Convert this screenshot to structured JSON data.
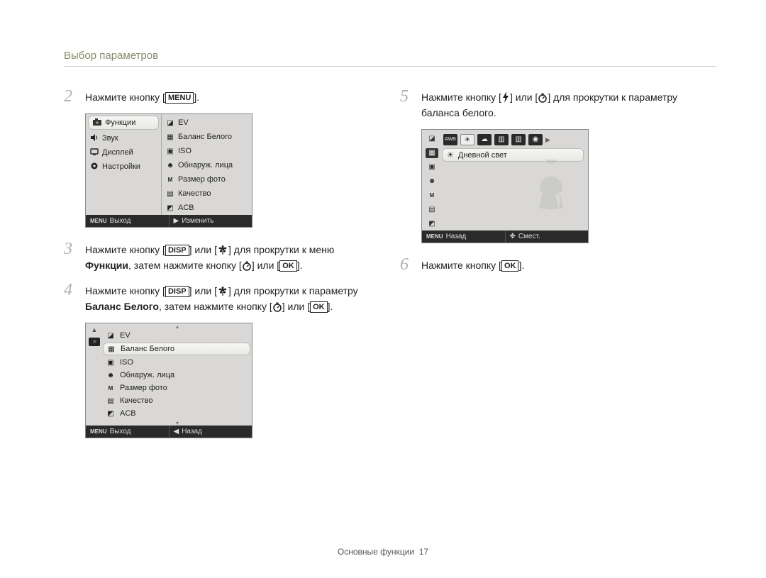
{
  "header": {
    "title": "Выбор параметров"
  },
  "footer": {
    "section": "Основные функции",
    "page": "17"
  },
  "buttons": {
    "menu": "MENU",
    "ok": "OK",
    "disp": "DISP"
  },
  "left": {
    "step2": {
      "num": "2",
      "pre": "Нажмите кнопку [",
      "post": "]."
    },
    "cam1": {
      "left_items": [
        {
          "icon": "camera",
          "label": "Функции",
          "selected": true
        },
        {
          "icon": "speaker",
          "label": "Звук",
          "selected": false
        },
        {
          "icon": "display",
          "label": "Дисплей",
          "selected": false
        },
        {
          "icon": "gear",
          "label": "Настройки",
          "selected": false
        }
      ],
      "right_items": [
        {
          "icon": "ev",
          "label": "EV"
        },
        {
          "icon": "wb",
          "label": "Баланс Белого"
        },
        {
          "icon": "iso",
          "label": "ISO"
        },
        {
          "icon": "face",
          "label": "Обнаруж. лица"
        },
        {
          "icon": "size",
          "label": "Размер фото"
        },
        {
          "icon": "quality",
          "label": "Качество"
        },
        {
          "icon": "acb",
          "label": "ACB"
        }
      ],
      "footer_left_label": "MENU",
      "footer_left_text": "Выход",
      "footer_right_icon": "▶",
      "footer_right_text": "Изменить"
    },
    "step3": {
      "num": "3",
      "parts": {
        "a": "Нажмите кнопку [",
        "b": "] или [",
        "c": "] для прокрутки к меню ",
        "bold": "Функции",
        "d": ", затем нажмите кнопку [",
        "e": "] или [",
        "f": "]."
      }
    },
    "step4": {
      "num": "4",
      "parts": {
        "a": "Нажмите кнопку [",
        "b": "] или [",
        "c": "] для прокрутки к параметру ",
        "bold": "Баланс Белого",
        "d": ", затем нажмите кнопку [",
        "e": "] или [",
        "f": "]."
      }
    },
    "cam2": {
      "rows": [
        {
          "icon": "ev",
          "label": "EV",
          "selected": false
        },
        {
          "icon": "wb",
          "label": "Баланс Белого",
          "selected": true
        },
        {
          "icon": "iso",
          "label": "ISO",
          "selected": false
        },
        {
          "icon": "face",
          "label": "Обнаруж. лица",
          "selected": false
        },
        {
          "icon": "size",
          "label": "Размер фото",
          "selected": false
        },
        {
          "icon": "quality",
          "label": "Качество",
          "selected": false
        },
        {
          "icon": "acb",
          "label": "ACB",
          "selected": false
        }
      ],
      "footer_left_label": "MENU",
      "footer_left_text": "Выход",
      "footer_right_icon": "◀",
      "footer_right_text": "Назад"
    }
  },
  "right": {
    "step5": {
      "num": "5",
      "parts": {
        "a": "Нажмите кнопку [",
        "b": "] или [",
        "c": "] для прокрутки к параметру баланса белого."
      }
    },
    "cam3": {
      "left_icons": [
        "ev",
        "wb",
        "iso",
        "face",
        "size",
        "quality",
        "acb"
      ],
      "wb_options": [
        "AWB",
        "sun",
        "cloud",
        "fluor-h",
        "fluor-l",
        "tungsten"
      ],
      "selected_label": "Дневной свет",
      "footer_left_label": "MENU",
      "footer_left_text": "Назад",
      "footer_right_icon": "✥",
      "footer_right_text": "Смест."
    },
    "step6": {
      "num": "6",
      "pre": "Нажмите кнопку [",
      "post": "]."
    }
  }
}
